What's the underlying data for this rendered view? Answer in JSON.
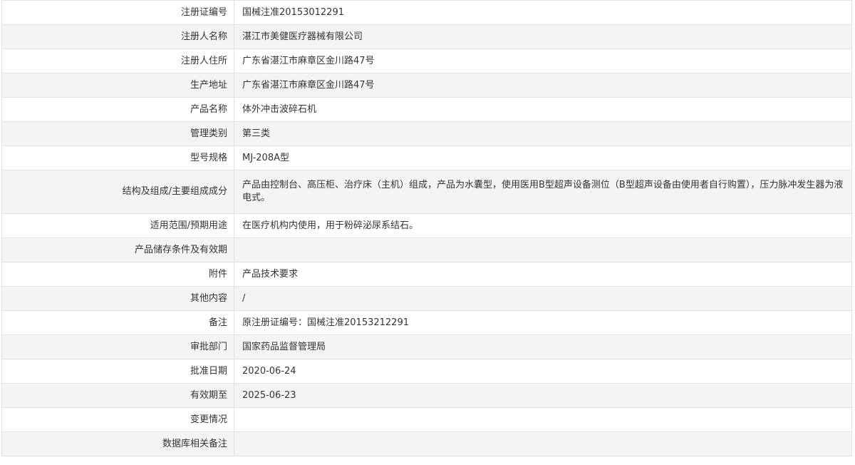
{
  "rows": [
    {
      "label": "注册证编号",
      "value": "国械注准20153012291"
    },
    {
      "label": "注册人名称",
      "value": "湛江市美健医疗器械有限公司"
    },
    {
      "label": "注册人住所",
      "value": "广东省湛江市麻章区金川路47号"
    },
    {
      "label": "生产地址",
      "value": "广东省湛江市麻章区金川路47号"
    },
    {
      "label": "产品名称",
      "value": "体外冲击波碎石机"
    },
    {
      "label": "管理类别",
      "value": "第三类"
    },
    {
      "label": "型号规格",
      "value": "MJ-208A型"
    },
    {
      "label": "结构及组成/主要组成成分",
      "value": "产品由控制台、高压柜、治疗床（主机）组成，产品为水囊型，使用医用B型超声设备测位（B型超声设备由使用者自行购置），压力脉冲发生器为液电式。"
    },
    {
      "label": "适用范围/预期用途",
      "value": "在医疗机构内使用，用于粉碎泌尿系结石。"
    },
    {
      "label": "产品储存条件及有效期",
      "value": ""
    },
    {
      "label": "附件",
      "value": "产品技术要求"
    },
    {
      "label": "其他内容",
      "value": "/"
    },
    {
      "label": "备注",
      "value": "原注册证编号：国械注准20153212291"
    },
    {
      "label": "审批部门",
      "value": "国家药品监督管理局"
    },
    {
      "label": "批准日期",
      "value": "2020-06-24"
    },
    {
      "label": "有效期至",
      "value": "2025-06-23"
    },
    {
      "label": "变更情况",
      "value": ""
    },
    {
      "label": "数据库相关备注",
      "value": ""
    }
  ]
}
